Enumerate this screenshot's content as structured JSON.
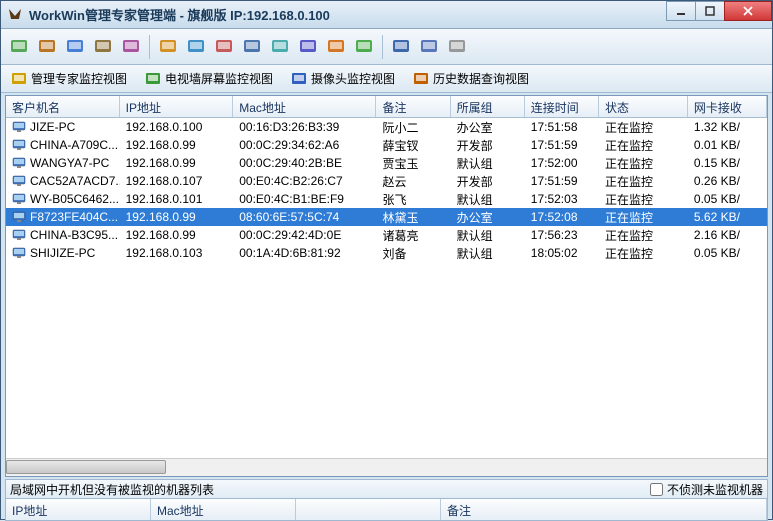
{
  "window": {
    "title": "WorkWin管理专家管理端 - 旗舰版 IP:192.168.0.100"
  },
  "tabs": [
    {
      "label": "管理专家监控视图"
    },
    {
      "label": "电视墙屏幕监控视图"
    },
    {
      "label": "摄像头监控视图"
    },
    {
      "label": "历史数据查询视图"
    }
  ],
  "columns": {
    "c0": "客户机名",
    "c1": "IP地址",
    "c2": "Mac地址",
    "c3": "备注",
    "c4": "所属组",
    "c5": "连接时间",
    "c6": "状态",
    "c7": "网卡接收"
  },
  "rows": [
    {
      "name": "JIZE-PC",
      "ip": "192.168.0.100",
      "mac": "00:16:D3:26:B3:39",
      "remark": "阮小二",
      "group": "办公室",
      "time": "17:51:58",
      "status": "正在监控",
      "rx": "1.32 KB/",
      "sel": false
    },
    {
      "name": "CHINA-A709C...",
      "ip": "192.168.0.99",
      "mac": "00:0C:29:34:62:A6",
      "remark": "薛宝钗",
      "group": "开发部",
      "time": "17:51:59",
      "status": "正在监控",
      "rx": "0.01 KB/",
      "sel": false
    },
    {
      "name": "WANGYA7-PC",
      "ip": "192.168.0.99",
      "mac": "00:0C:29:40:2B:BE",
      "remark": "贾宝玉",
      "group": "默认组",
      "time": "17:52:00",
      "status": "正在监控",
      "rx": "0.15 KB/",
      "sel": false
    },
    {
      "name": "CAC52A7ACD7...",
      "ip": "192.168.0.107",
      "mac": "00:E0:4C:B2:26:C7",
      "remark": "赵云",
      "group": "开发部",
      "time": "17:51:59",
      "status": "正在监控",
      "rx": "0.26 KB/",
      "sel": false
    },
    {
      "name": "WY-B05C6462...",
      "ip": "192.168.0.101",
      "mac": "00:E0:4C:B1:BE:F9",
      "remark": "张飞",
      "group": "默认组",
      "time": "17:52:03",
      "status": "正在监控",
      "rx": "0.05 KB/",
      "sel": false
    },
    {
      "name": "F8723FE404C...",
      "ip": "192.168.0.99",
      "mac": "08:60:6E:57:5C:74",
      "remark": "林黛玉",
      "group": "办公室",
      "time": "17:52:08",
      "status": "正在监控",
      "rx": "5.62 KB/",
      "sel": true
    },
    {
      "name": "CHINA-B3C95...",
      "ip": "192.168.0.99",
      "mac": "00:0C:29:42:4D:0E",
      "remark": "诸葛亮",
      "group": "默认组",
      "time": "17:56:23",
      "status": "正在监控",
      "rx": "2.16 KB/",
      "sel": false
    },
    {
      "name": "SHIJIZE-PC",
      "ip": "192.168.0.103",
      "mac": "00:1A:4D:6B:81:92",
      "remark": "刘备",
      "group": "默认组",
      "time": "18:05:02",
      "status": "正在监控",
      "rx": "0.05 KB/",
      "sel": false
    }
  ],
  "bottom": {
    "label": "局域网中开机但没有被监视的机器列表",
    "checkbox": "不侦测未监视机器",
    "cols": {
      "c0": "IP地址",
      "c1": "Mac地址",
      "c2": "",
      "c3": "备注"
    }
  },
  "toolbar_icons": [
    "session-icon",
    "computers-icon",
    "screen-icon",
    "capture-icon",
    "wall-icon",
    "sep",
    "folder-icon",
    "export-icon",
    "settings-icon",
    "globe-icon",
    "search-icon",
    "refresh-icon",
    "report-icon",
    "video-icon",
    "sep",
    "user-icon",
    "contact-icon",
    "help-icon"
  ],
  "colors": {
    "selection": "#2e7cd6"
  }
}
